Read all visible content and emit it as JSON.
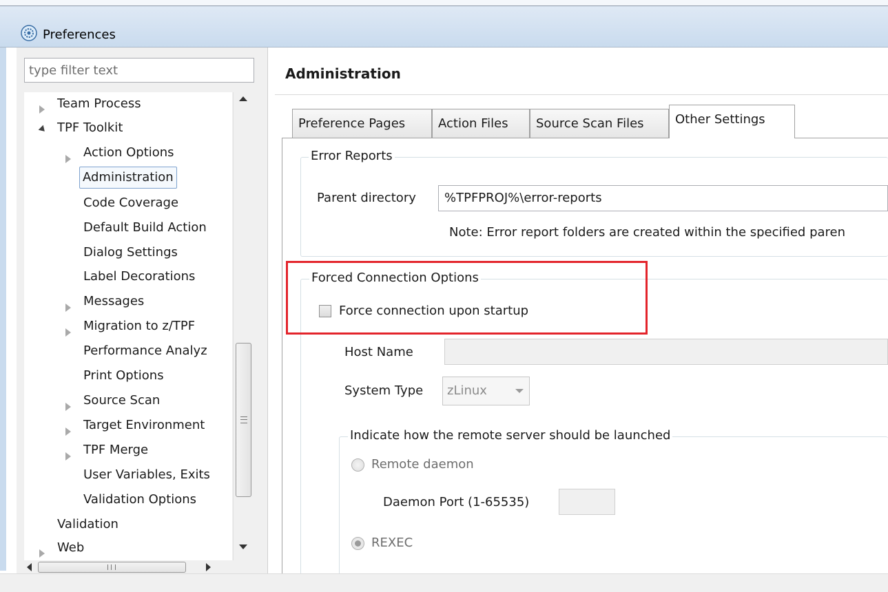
{
  "window": {
    "title": "Preferences"
  },
  "filter": {
    "placeholder": "type filter text"
  },
  "tree": {
    "items": [
      {
        "label": "Team Process"
      },
      {
        "label": "TPF Toolkit"
      },
      {
        "label": "Action Options"
      },
      {
        "label": "Administration"
      },
      {
        "label": "Code Coverage"
      },
      {
        "label": "Default Build Action"
      },
      {
        "label": "Dialog Settings"
      },
      {
        "label": "Label Decorations"
      },
      {
        "label": "Messages"
      },
      {
        "label": "Migration to z/TPF"
      },
      {
        "label": "Performance Analyz"
      },
      {
        "label": "Print Options"
      },
      {
        "label": "Source Scan"
      },
      {
        "label": "Target Environment"
      },
      {
        "label": "TPF Merge"
      },
      {
        "label": "User Variables, Exits"
      },
      {
        "label": "Validation Options"
      },
      {
        "label": "Validation"
      },
      {
        "label": "Web"
      }
    ]
  },
  "page": {
    "title": "Administration"
  },
  "tabs": [
    {
      "label": "Preference Pages"
    },
    {
      "label": "Action Files"
    },
    {
      "label": "Source Scan Files"
    },
    {
      "label": "Other Settings"
    }
  ],
  "error_reports": {
    "title": "Error Reports",
    "parent_label": "Parent directory",
    "parent_value": "%TPFPROJ%\\error-reports",
    "note": "Note: Error report folders are created within the specified paren"
  },
  "forced_connection": {
    "title": "Forced Connection Options",
    "checkbox_label": "Force connection upon startup",
    "host_label": "Host Name",
    "host_value": "",
    "system_type_label": "System Type",
    "system_type_value": "zLinux",
    "launch_group_title": "Indicate how the remote server should be launched",
    "remote_daemon_label": "Remote daemon",
    "daemon_port_label": "Daemon Port (1-65535)",
    "daemon_port_value": "",
    "rexec_label": "REXEC"
  }
}
